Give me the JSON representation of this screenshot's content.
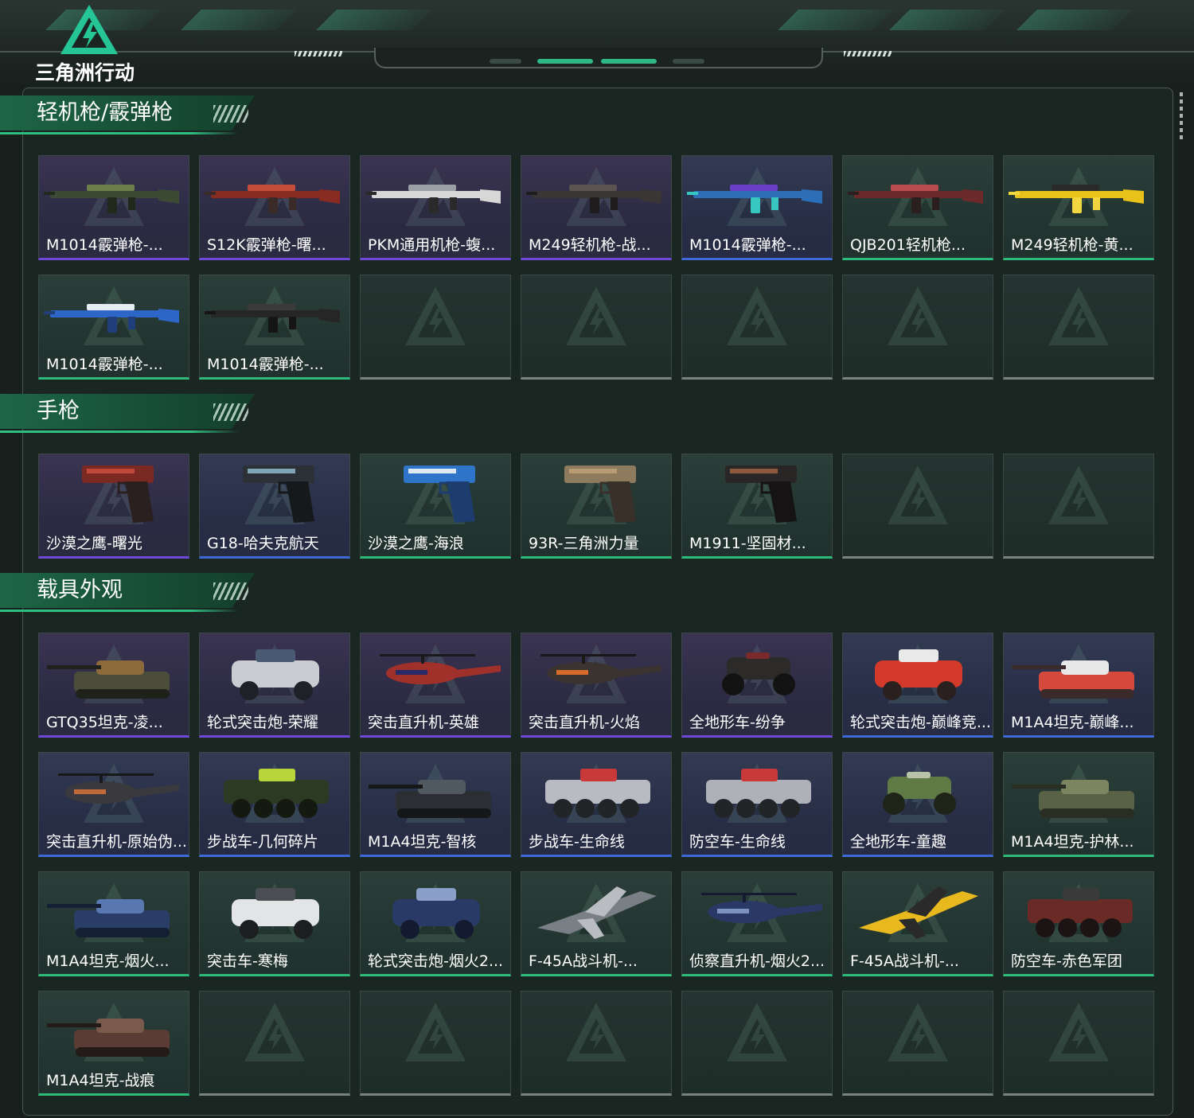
{
  "app": {
    "title": "三角洲行动"
  },
  "colors": {
    "purple": "#6e49d8",
    "blue": "#3f68d8",
    "green": "#2dba7b",
    "empty": "#7b837f",
    "accent": "#1d6646"
  },
  "sections": [
    {
      "title": "轻机枪/霰弹枪",
      "rows": [
        [
          {
            "name": "M1014霰弹枪-...",
            "rarity": "purple",
            "art": "gun-camo"
          },
          {
            "name": "S12K霰弹枪-曙...",
            "rarity": "purple",
            "art": "gun-red"
          },
          {
            "name": "PKM通用机枪-蝮...",
            "rarity": "purple",
            "art": "gun-white"
          },
          {
            "name": "M249轻机枪-战...",
            "rarity": "purple",
            "art": "gun-dark"
          },
          {
            "name": "M1014霰弹枪-...",
            "rarity": "blue",
            "art": "gun-neon"
          },
          {
            "name": "QJB201轻机枪...",
            "rarity": "green",
            "art": "gun-rust"
          },
          {
            "name": "M249轻机枪-黄...",
            "rarity": "green",
            "art": "gun-yellow"
          }
        ],
        [
          {
            "name": "M1014霰弹枪-...",
            "rarity": "green",
            "art": "gun-blue"
          },
          {
            "name": "M1014霰弹枪-...",
            "rarity": "green",
            "art": "gun-black"
          },
          {
            "name": "",
            "rarity": "empty"
          },
          {
            "name": "",
            "rarity": "empty"
          },
          {
            "name": "",
            "rarity": "empty"
          },
          {
            "name": "",
            "rarity": "empty"
          },
          {
            "name": "",
            "rarity": "empty"
          }
        ]
      ]
    },
    {
      "title": "手枪",
      "rows": [
        [
          {
            "name": "沙漠之鹰-曙光",
            "rarity": "purple",
            "art": "pistol-red"
          },
          {
            "name": "G18-哈夫克航天",
            "rarity": "blue",
            "art": "pistol-dark"
          },
          {
            "name": "沙漠之鹰-海浪",
            "rarity": "green",
            "art": "pistol-blue"
          },
          {
            "name": "93R-三角洲力量",
            "rarity": "green",
            "art": "pistol-tan"
          },
          {
            "name": "M1911-坚固材...",
            "rarity": "green",
            "art": "pistol-black"
          },
          {
            "name": "",
            "rarity": "empty"
          },
          {
            "name": "",
            "rarity": "empty"
          }
        ]
      ]
    },
    {
      "title": "载具外观",
      "rows": [
        [
          {
            "name": "GTQ35坦克-凌...",
            "rarity": "purple",
            "art": "tank-camo"
          },
          {
            "name": "轮式突击炮-荣耀",
            "rarity": "purple",
            "art": "buggy-white"
          },
          {
            "name": "突击直升机-英雄",
            "rarity": "purple",
            "art": "heli-red"
          },
          {
            "name": "突击直升机-火焰",
            "rarity": "purple",
            "art": "heli-flame"
          },
          {
            "name": "全地形车-纷争",
            "rarity": "purple",
            "art": "atv-dark"
          },
          {
            "name": "轮式突击炮-巅峰竞...",
            "rarity": "blue",
            "art": "buggy-red"
          },
          {
            "name": "M1A4坦克-巅峰...",
            "rarity": "blue",
            "art": "tank-redwhite"
          }
        ],
        [
          {
            "name": "突击直升机-原始伪...",
            "rarity": "blue",
            "art": "heli-dark"
          },
          {
            "name": "步战车-几何碎片",
            "rarity": "blue",
            "art": "ifv-green"
          },
          {
            "name": "M1A4坦克-智核",
            "rarity": "blue",
            "art": "tank-black"
          },
          {
            "name": "步战车-生命线",
            "rarity": "blue",
            "art": "ifv-white"
          },
          {
            "name": "防空车-生命线",
            "rarity": "blue",
            "art": "ifv-white2"
          },
          {
            "name": "全地形车-童趣",
            "rarity": "blue",
            "art": "atv-green"
          },
          {
            "name": "M1A4坦克-护林...",
            "rarity": "green",
            "art": "tank-olive"
          }
        ],
        [
          {
            "name": "M1A4坦克-烟火...",
            "rarity": "green",
            "art": "tank-blue"
          },
          {
            "name": "突击车-寒梅",
            "rarity": "green",
            "art": "truck-white"
          },
          {
            "name": "轮式突击炮-烟火2...",
            "rarity": "green",
            "art": "buggy-blue"
          },
          {
            "name": "F-45A战斗机-...",
            "rarity": "green",
            "art": "jet-grey"
          },
          {
            "name": "侦察直升机-烟火2...",
            "rarity": "green",
            "art": "heli-blue"
          },
          {
            "name": "F-45A战斗机-...",
            "rarity": "green",
            "art": "jet-yellow"
          },
          {
            "name": "防空车-赤色军团",
            "rarity": "green",
            "art": "ifv-red"
          }
        ],
        [
          {
            "name": "M1A4坦克-战痕",
            "rarity": "green",
            "art": "tank-brown"
          },
          {
            "name": "",
            "rarity": "empty"
          },
          {
            "name": "",
            "rarity": "empty"
          },
          {
            "name": "",
            "rarity": "empty"
          },
          {
            "name": "",
            "rarity": "empty"
          },
          {
            "name": "",
            "rarity": "empty"
          },
          {
            "name": "",
            "rarity": "empty"
          }
        ]
      ]
    }
  ]
}
